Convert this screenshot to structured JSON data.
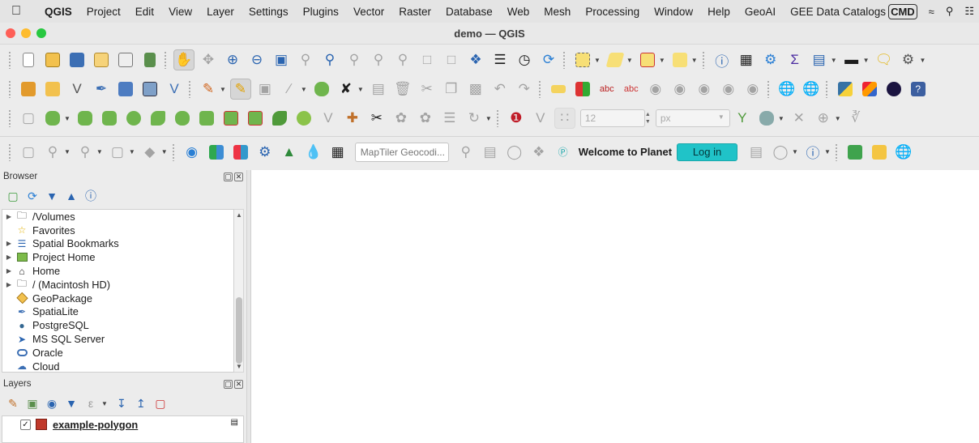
{
  "menubar": {
    "apple_icon": "apple-logo-icon",
    "app_name": "QGIS",
    "items": [
      "Project",
      "Edit",
      "View",
      "Layer",
      "Settings",
      "Plugins",
      "Vector",
      "Raster",
      "Database",
      "Web",
      "Mesh",
      "Processing",
      "Window",
      "Help",
      "GeoAI",
      "GEE Data Catalogs"
    ],
    "status_icons": [
      "cmd-keyboard-icon",
      "wifi-icon",
      "spotlight-search-icon",
      "control-center-icon"
    ],
    "cmd_badge": "CMD"
  },
  "window": {
    "title": "demo — QGIS",
    "lights": {
      "close": "#fe5f57",
      "minimize": "#febc2e",
      "zoom": "#28c840"
    }
  },
  "toolbar3": {
    "size_value": "12",
    "unit_value": "px"
  },
  "toolbar4": {
    "geocoder_placeholder": "MapTiler Geocodi...",
    "planet_welcome": "Welcome to Planet",
    "login_label": "Log in"
  },
  "browser": {
    "title": "Browser",
    "items": [
      {
        "label": "/Volumes",
        "expandable": true,
        "icon": "folder-icon"
      },
      {
        "label": "Favorites",
        "expandable": false,
        "icon": "star-icon"
      },
      {
        "label": "Spatial Bookmarks",
        "expandable": true,
        "icon": "bookmark-icon"
      },
      {
        "label": "Project Home",
        "expandable": true,
        "icon": "project-home-icon"
      },
      {
        "label": "Home",
        "expandable": true,
        "icon": "home-icon"
      },
      {
        "label": "/ (Macintosh HD)",
        "expandable": true,
        "icon": "folder-icon"
      },
      {
        "label": "GeoPackage",
        "expandable": false,
        "icon": "geopackage-icon"
      },
      {
        "label": "SpatiaLite",
        "expandable": false,
        "icon": "spatialite-icon"
      },
      {
        "label": "PostgreSQL",
        "expandable": false,
        "icon": "postgresql-icon"
      },
      {
        "label": "MS SQL Server",
        "expandable": false,
        "icon": "mssql-icon"
      },
      {
        "label": "Oracle",
        "expandable": false,
        "icon": "oracle-icon"
      },
      {
        "label": "Cloud",
        "expandable": false,
        "icon": "cloud-icon"
      }
    ]
  },
  "layers": {
    "title": "Layers",
    "items": [
      {
        "label": "example-polygon",
        "checked": true,
        "check_mark": "✓"
      }
    ]
  }
}
